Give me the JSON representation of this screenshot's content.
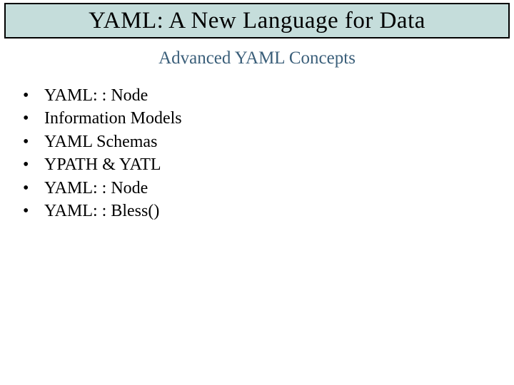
{
  "title": "YAML: A New Language for Data",
  "subtitle": "Advanced YAML Concepts",
  "bullet_char": "•",
  "bullets": [
    "YAML: : Node",
    "Information Models",
    "YAML Schemas",
    "YPATH & YATL",
    "YAML: : Node",
    "YAML: : Bless()"
  ]
}
